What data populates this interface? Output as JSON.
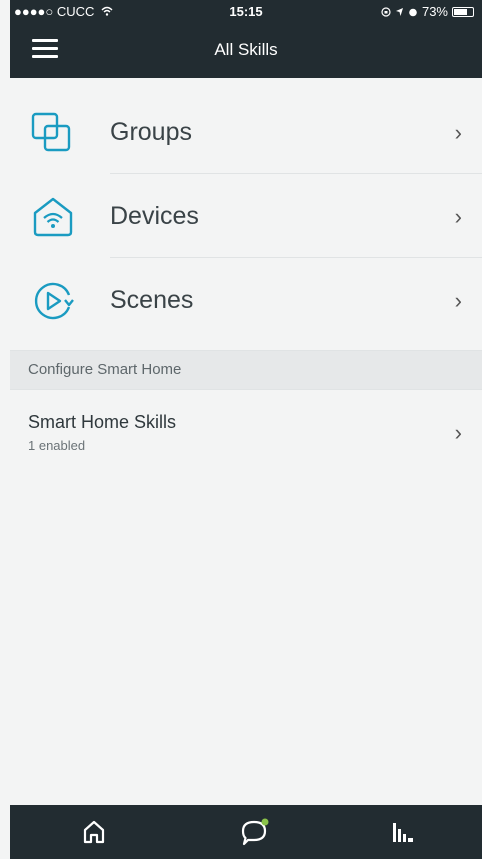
{
  "status_bar": {
    "carrier": "●●●●○ CUCC",
    "time": "15:15",
    "battery_percent": "73%",
    "battery_level": 0.73
  },
  "header": {
    "title": "All Skills",
    "menu_icon": "hamburger-menu-icon"
  },
  "list": {
    "items": [
      {
        "label": "Groups",
        "icon": "groups-icon"
      },
      {
        "label": "Devices",
        "icon": "devices-icon"
      },
      {
        "label": "Scenes",
        "icon": "scenes-icon"
      }
    ]
  },
  "section": {
    "label": "Configure Smart Home"
  },
  "skills": {
    "title": "Smart Home Skills",
    "subtitle": "1 enabled"
  },
  "bottom_nav": {
    "items": [
      "home-icon",
      "chat-icon",
      "activity-icon"
    ]
  },
  "colors": {
    "accent": "#1a9bc1",
    "header_bg": "#222c31",
    "background": "#f3f4f4",
    "notification_dot": "#8bc34a"
  }
}
